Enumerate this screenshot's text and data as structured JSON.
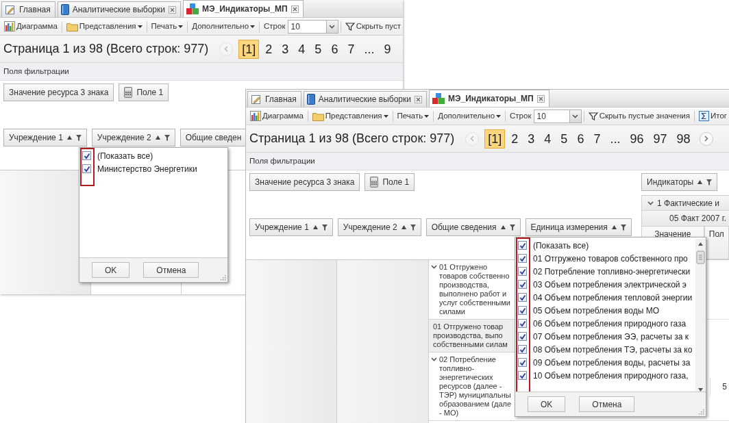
{
  "screens": [
    {
      "tabs": [
        {
          "label": "Главная",
          "closable": false,
          "selected": false
        },
        {
          "label": "Аналитические выборки",
          "closable": true,
          "selected": false
        },
        {
          "label": "МЭ_Индикаторы_МП",
          "closable": true,
          "selected": true
        }
      ],
      "toolbar": [
        {
          "kind": "diagram",
          "label": "Диаграмма"
        },
        {
          "kind": "views",
          "label": "Представления"
        },
        {
          "kind": "menu",
          "label": "Печать"
        },
        {
          "kind": "menu",
          "label": "Дополнительно"
        },
        {
          "kind": "select",
          "label": "Строк",
          "value": "10"
        },
        {
          "kind": "hide_empty",
          "label": "Скрыть пуст"
        }
      ],
      "pager": {
        "summary": "Страница 1 из 98 (Всего строк: 977)",
        "prev_disabled": true,
        "pages": [
          {
            "label": "[1]",
            "selected": true
          },
          {
            "label": "2",
            "selected": false
          },
          {
            "label": "3",
            "selected": false
          },
          {
            "label": "4",
            "selected": false
          },
          {
            "label": "5",
            "selected": false
          },
          {
            "label": "6",
            "selected": false
          },
          {
            "label": "7",
            "selected": false
          },
          {
            "label": "...",
            "selected": false
          },
          {
            "label": "9",
            "selected": false
          }
        ]
      },
      "filter_label": "Поля фильтрации",
      "filter_fields": [
        {
          "kind": "measure",
          "label": "Значение ресурса 3 знака"
        },
        {
          "kind": "calculated",
          "label": "Поле 1"
        }
      ],
      "row_fields": [
        {
          "label": "Учреждение 1",
          "sortable": true,
          "filterable": true
        },
        {
          "label": "Учреждение 2",
          "sortable": true,
          "filterable": true
        },
        {
          "label": "Общие сведен"
        }
      ],
      "popup": {
        "highlight": true,
        "items": [
          {
            "label": "(Показать все)",
            "checked": true
          },
          {
            "label": "Министерство Энергетики",
            "checked": true
          }
        ],
        "buttons": [
          "OK",
          "Отмена"
        ]
      }
    },
    {
      "tabs": [
        {
          "label": "Главная",
          "closable": false,
          "selected": false
        },
        {
          "label": "Аналитические выборки",
          "closable": true,
          "selected": false
        },
        {
          "label": "МЭ_Индикаторы_МП",
          "closable": true,
          "selected": true
        }
      ],
      "toolbar": [
        {
          "kind": "diagram",
          "label": "Диаграмма"
        },
        {
          "kind": "views",
          "label": "Представления"
        },
        {
          "kind": "menu",
          "label": "Печать"
        },
        {
          "kind": "menu",
          "label": "Дополнительно"
        },
        {
          "kind": "select",
          "label": "Строк",
          "value": "10"
        },
        {
          "kind": "hide_empty",
          "label": "Скрыть пустые значения"
        },
        {
          "kind": "totals",
          "label": "Итог"
        }
      ],
      "pager": {
        "summary": "Страница 1 из 98 (Всего строк: 977)",
        "prev_disabled": true,
        "next_disabled": false,
        "pages": [
          {
            "label": "[1]",
            "selected": true
          },
          {
            "label": "2",
            "selected": false
          },
          {
            "label": "3",
            "selected": false
          },
          {
            "label": "4",
            "selected": false
          },
          {
            "label": "5",
            "selected": false
          },
          {
            "label": "6",
            "selected": false
          },
          {
            "label": "7",
            "selected": false
          },
          {
            "label": "...",
            "selected": false
          },
          {
            "label": "96",
            "selected": false
          },
          {
            "label": "97",
            "selected": false
          },
          {
            "label": "98",
            "selected": false
          }
        ]
      },
      "filter_label": "Поля фильтрации",
      "filter_fields": [
        {
          "kind": "measure",
          "label": "Значение ресурса 3 знака"
        },
        {
          "kind": "calculated",
          "label": "Поле 1"
        }
      ],
      "column_fields": [
        {
          "label": "Индикаторы",
          "sortable": true,
          "filterable": true
        }
      ],
      "column_headers": [
        {
          "text": "1 Фактические и",
          "expanded": true
        },
        {
          "text": "05 Факт 2007 г."
        }
      ],
      "measures": [
        "Значение",
        "Пол"
      ],
      "row_fields": [
        {
          "label": "Учреждение 1",
          "sortable": true,
          "filterable": true
        },
        {
          "label": "Учреждение 2",
          "sortable": true,
          "filterable": true
        },
        {
          "label": "Общие сведения",
          "sortable": true,
          "filterable": true
        },
        {
          "label": "Единица измерения",
          "sortable": true,
          "filterable": true
        }
      ],
      "rows": [
        {
          "kind": "group",
          "expanded": true,
          "text": "01 Отгружено товаров собственно производства, выполнено работ и услуг собственными силами"
        },
        {
          "kind": "total",
          "text": "01 Отгружено товар производства, выпо собственными силам"
        },
        {
          "kind": "group",
          "expanded": true,
          "text": "02 Потребление топливно-энергетических ресурсов (далее - ТЭР) муниципальны образованием (дале - МО)",
          "last_column_value": "5"
        }
      ],
      "popup": {
        "highlight": true,
        "scrollbar": true,
        "items": [
          {
            "label": "(Показать все)",
            "checked": true
          },
          {
            "label": "01 Отгружено товаров собственного про",
            "checked": true
          },
          {
            "label": "02 Потребление топливно-энергетически",
            "checked": true
          },
          {
            "label": "03 Объем потребления электрической э",
            "checked": true
          },
          {
            "label": "04 Объем потребления тепловой энергии",
            "checked": true
          },
          {
            "label": "05 Объем потребления воды МО",
            "checked": true
          },
          {
            "label": "06 Объем потребления природного газа",
            "checked": true
          },
          {
            "label": "07 Объем потребления ЭЭ, расчеты за к",
            "checked": true
          },
          {
            "label": "08 Объем потребления ТЭ, расчеты за ко",
            "checked": true
          },
          {
            "label": "09 Объем потребления воды, расчеты за",
            "checked": true
          },
          {
            "label": "10 Объем потребления природного газа,",
            "checked": true
          }
        ],
        "buttons": [
          "OK",
          "Отмена"
        ]
      }
    }
  ]
}
